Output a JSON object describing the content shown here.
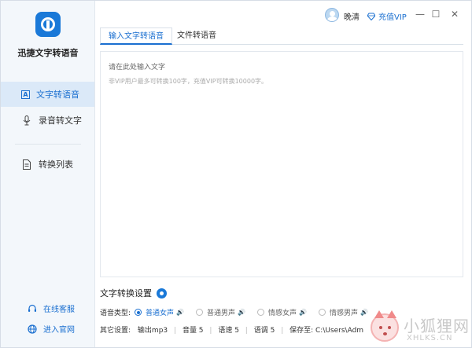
{
  "app": {
    "title": "迅捷文字转语音"
  },
  "sidebar": {
    "items": [
      {
        "label": "文字转语音",
        "active": true
      },
      {
        "label": "录音转文字",
        "active": false
      },
      {
        "label": "转换列表",
        "active": false
      }
    ],
    "icons": {
      "text_to_speech": "A",
      "record": "microphone-icon",
      "list": "document-icon"
    },
    "bottom": [
      {
        "label": "在线客服",
        "icon": "headset-icon"
      },
      {
        "label": "进入官网",
        "icon": "globe-icon"
      }
    ]
  },
  "header": {
    "username": "晚清",
    "vip_label": "充值VIP",
    "minimize": "—",
    "maximize": "☐",
    "close": "✕"
  },
  "tabs": [
    {
      "label": "输入文字转语音",
      "active": true
    },
    {
      "label": "文件转语音",
      "active": false
    }
  ],
  "editor": {
    "placeholder": "请在此处输入文字",
    "hint": "非VIP用户最多可转换100字，充值VIP可转换10000字。"
  },
  "settings": {
    "title": "文字转换设置",
    "voice_label": "语音类型:",
    "voices": [
      {
        "label": "普通女声",
        "selected": true
      },
      {
        "label": "普通男声",
        "selected": false
      },
      {
        "label": "情感女声",
        "selected": false
      },
      {
        "label": "情感男声",
        "selected": false
      }
    ],
    "speaker_glyph": "🔊",
    "other_label": "其它设置:",
    "output": "输出mp3",
    "volume": "音量 5",
    "speed": "语速 5",
    "pitch": "语调 5",
    "save_to": "保存至: C:\\Users\\Administrator\\De"
  },
  "watermark": {
    "cn": "小狐狸网",
    "en": "XHLKS.CN"
  },
  "colors": {
    "accent": "#1a6fd0",
    "sidebar_bg": "#f3f7fb",
    "active_bg": "#dbe9f8"
  }
}
